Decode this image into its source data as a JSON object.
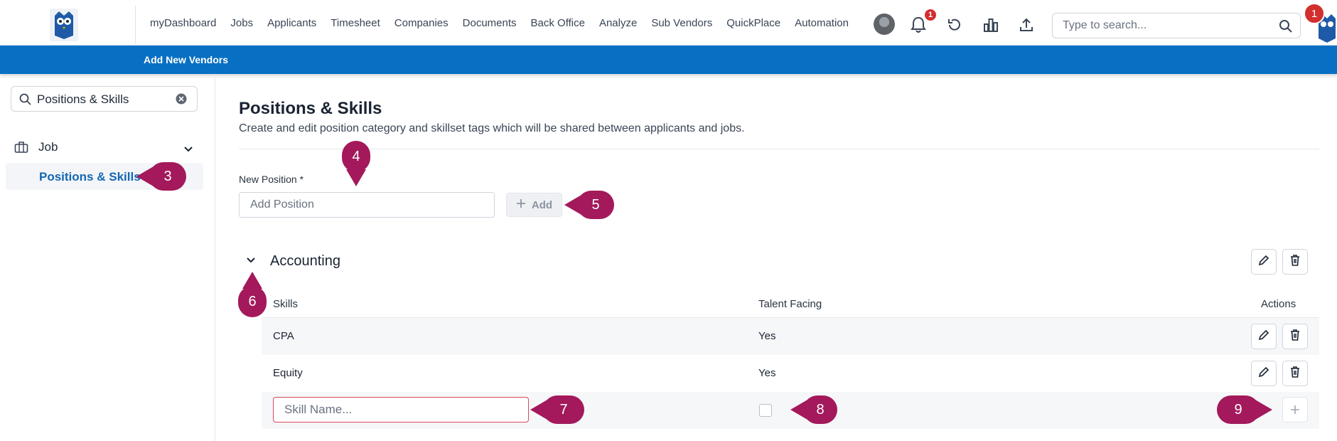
{
  "nav": {
    "items": [
      "myDashboard",
      "Jobs",
      "Applicants",
      "Timesheet",
      "Companies",
      "Documents",
      "Back Office",
      "Analyze",
      "Sub Vendors",
      "QuickPlace",
      "Automation"
    ],
    "notification_count": "1",
    "search_placeholder": "Type to search...",
    "corner_badge": "1"
  },
  "bluebar": {
    "label": "Add New Vendors"
  },
  "sidebar": {
    "search_value": "Positions & Skills",
    "group_label": "Job",
    "active_item": "Positions & Skills"
  },
  "main": {
    "title": "Positions & Skills",
    "subtitle": "Create and edit position category and skillset tags which will be shared between applicants and jobs.",
    "new_position_label": "New Position *",
    "new_position_placeholder": "Add Position",
    "add_button_label": "Add",
    "category": {
      "name": "Accounting",
      "headers": {
        "skills": "Skills",
        "talent_facing": "Talent Facing",
        "actions": "Actions"
      },
      "rows": [
        {
          "skill": "CPA",
          "talent_facing": "Yes"
        },
        {
          "skill": "Equity",
          "talent_facing": "Yes"
        }
      ],
      "new_skill_placeholder": "Skill Name..."
    }
  },
  "markers": [
    "1",
    "3",
    "4",
    "5",
    "6",
    "7",
    "8",
    "9"
  ],
  "colors": {
    "brand_blue": "#0770c3",
    "marker": "#a3195b",
    "active_link": "#1366b3",
    "badge": "#d32f2f"
  }
}
